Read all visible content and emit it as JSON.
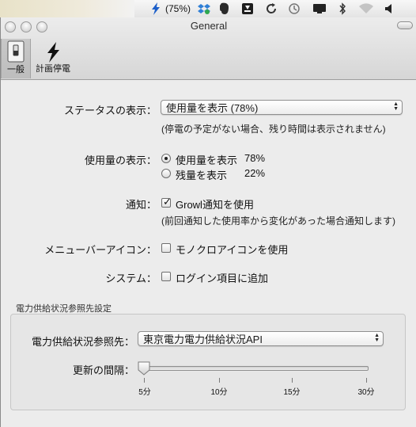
{
  "menubar": {
    "battery_percent": "(75%)",
    "items": [
      "bolt-status-icon",
      "dropbox-icon",
      "evernote-icon",
      "spaces-icon",
      "sync-icon",
      "time-machine-icon",
      "display-icon",
      "bluetooth-icon",
      "wifi-icon",
      "volume-icon"
    ]
  },
  "window": {
    "title": "General"
  },
  "toolbar": {
    "items": [
      {
        "label": "一般",
        "icon": "toggle-switch-icon",
        "selected": true
      },
      {
        "label": "計画停電",
        "icon": "lightning-bolt-icon",
        "selected": false
      }
    ]
  },
  "status": {
    "label": "ステータスの表示：",
    "value": "使用量を表示 (78%)",
    "note": "(停電の予定がない場合、残り時間は表示されません)"
  },
  "usage": {
    "label": "使用量の表示：",
    "options": [
      {
        "text": "使用量を表示",
        "value": "78%",
        "selected": true
      },
      {
        "text": "残量を表示",
        "value": "22%",
        "selected": false
      }
    ]
  },
  "notify": {
    "label": "通知：",
    "checkbox": "Growl通知を使用",
    "checked": true,
    "note": "(前回通知した使用率から変化があった場合通知します)"
  },
  "menu_icon": {
    "label": "メニューバーアイコン：",
    "checkbox": "モノクロアイコンを使用",
    "checked": false
  },
  "system": {
    "label": "システム：",
    "checkbox": "ログイン項目に追加",
    "checked": false
  },
  "source_section": {
    "title": "電力供給状況参照先設定",
    "source_label": "電力供給状況参照先：",
    "source_value": "東京電力電力供給状況API",
    "interval_label": "更新の間隔：",
    "interval_ticks": [
      "5分",
      "10分",
      "15分",
      "30分"
    ],
    "interval_selected": "5分"
  }
}
